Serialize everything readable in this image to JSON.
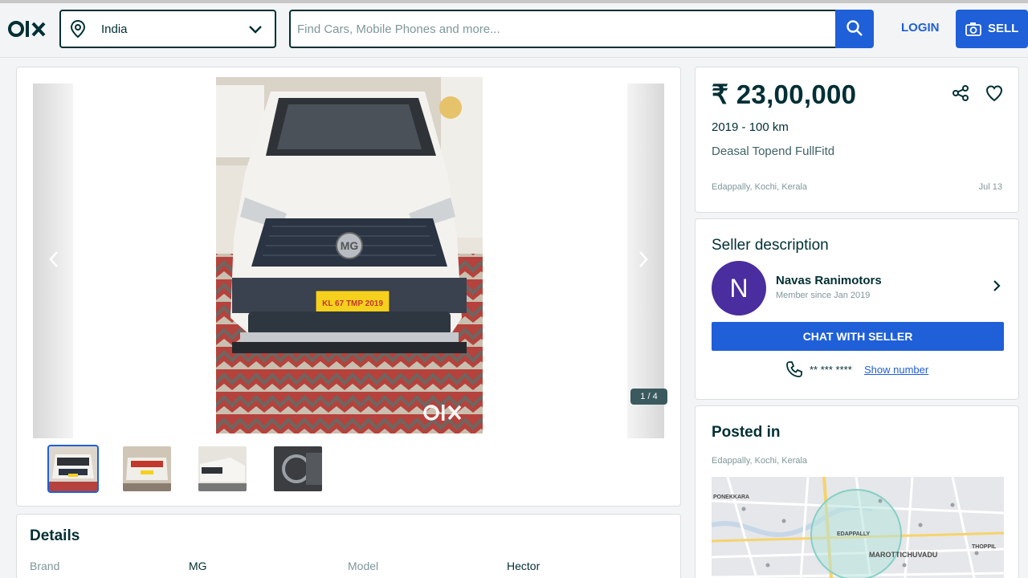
{
  "header": {
    "logo_text": "OLX",
    "location": "India",
    "search_placeholder": "Find Cars, Mobile Phones and more...",
    "login_label": "LOGIN",
    "sell_label": "SELL"
  },
  "gallery": {
    "counter": "1 / 4",
    "watermark": "OLX",
    "plate": "KL 67 TMP 2019"
  },
  "details": {
    "title": "Details",
    "fields": [
      {
        "key": "Brand",
        "value": "MG"
      },
      {
        "key": "Model",
        "value": "Hector"
      }
    ]
  },
  "listing": {
    "price": "₹ 23,00,000",
    "year_km": "2019 - 100 km",
    "title": "Deasal Topend FullFitd",
    "location": "Edappally, Kochi, Kerala",
    "date": "Jul 13"
  },
  "seller": {
    "heading": "Seller description",
    "initial": "N",
    "name": "Navas Ranimotors",
    "member_since": "Member since Jan 2019",
    "chat_label": "CHAT WITH SELLER",
    "masked_phone": "** *** ****",
    "show_number": "Show number"
  },
  "posted": {
    "title": "Posted in",
    "location": "Edappally, Kochi, Kerala",
    "map_labels": [
      "PONEKKARA",
      "EDAPPALLY",
      "MAROTTICHUVADU",
      "THOPPIL"
    ]
  },
  "colors": {
    "brand_blue": "#1f5fd8",
    "text_dark": "#002f34",
    "avatar_purple": "#4a2d9e"
  }
}
